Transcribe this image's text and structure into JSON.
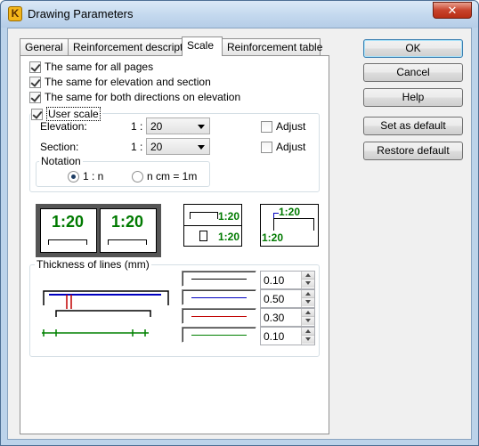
{
  "window": {
    "title": "Drawing Parameters",
    "app_icon_letter": "K",
    "close_glyph": "✕"
  },
  "tabs": [
    {
      "label": "General",
      "active": false
    },
    {
      "label": "Reinforcement description",
      "active": false
    },
    {
      "label": "Scale",
      "active": true
    },
    {
      "label": "Reinforcement table",
      "active": false
    }
  ],
  "options": {
    "same_all_pages": {
      "label": "The same for all pages",
      "checked": true
    },
    "same_elev_section": {
      "label": "The same for elevation and section",
      "checked": true
    },
    "same_both_directions": {
      "label": "The same for both directions on elevation",
      "checked": true
    }
  },
  "user_scale": {
    "label": "User scale",
    "checked": true,
    "elevation": {
      "label": "Elevation:",
      "prefix": "1 :",
      "value": "20",
      "adjust_label": "Adjust",
      "adjust_checked": false
    },
    "section": {
      "label": "Section:",
      "prefix": "1 :",
      "value": "20",
      "adjust_label": "Adjust",
      "adjust_checked": false
    },
    "notation": {
      "legend": "Notation",
      "options": [
        {
          "label": "1 : n",
          "checked": true
        },
        {
          "label": "n cm = 1m",
          "checked": false
        }
      ]
    }
  },
  "previews": {
    "scale_text": "1:20"
  },
  "thickness": {
    "legend": "Thickness of lines (mm)",
    "lines": [
      {
        "color": "#000000",
        "value": "0.10"
      },
      {
        "color": "#0000c0",
        "value": "0.50"
      },
      {
        "color": "#c00000",
        "value": "0.30"
      },
      {
        "color": "#008000",
        "value": "0.10"
      }
    ]
  },
  "buttons": {
    "ok": "OK",
    "cancel": "Cancel",
    "help": "Help",
    "set_default": "Set as default",
    "restore_default": "Restore default"
  }
}
